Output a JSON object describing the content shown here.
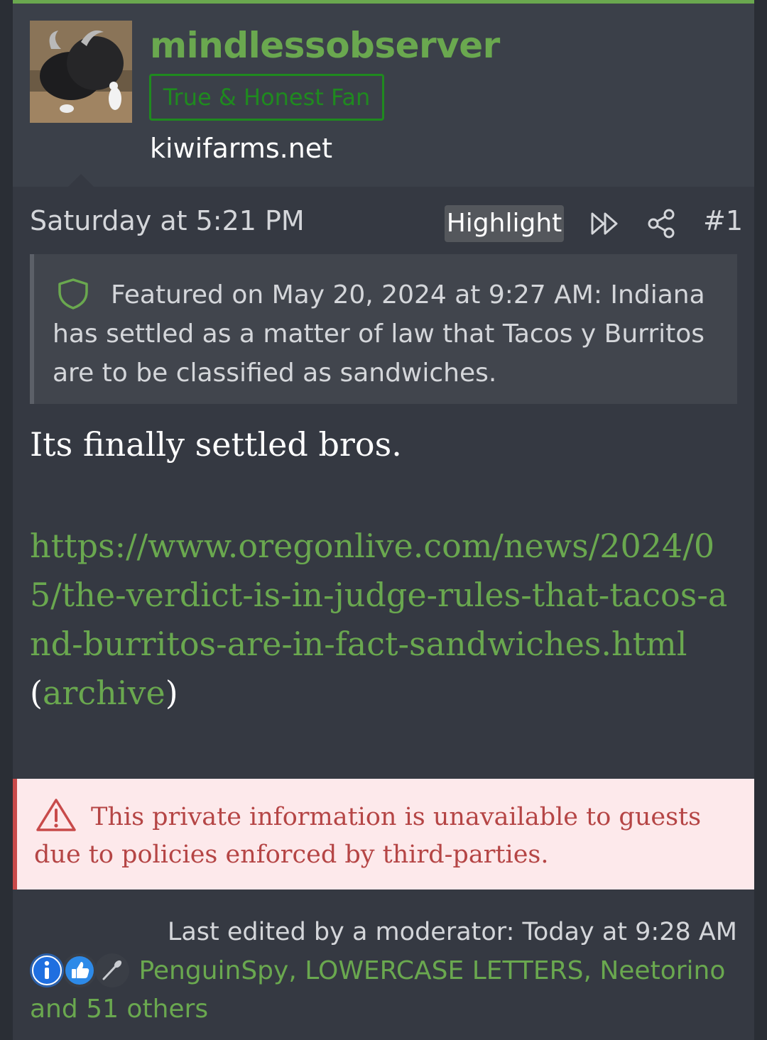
{
  "user": {
    "username": "mindlessobserver",
    "title": "True & Honest Fan",
    "site": "kiwifarms.net"
  },
  "post": {
    "date": "Saturday at 5:21 PM",
    "highlight_label": "Highlight",
    "number": "#1",
    "featured_text": "Featured on May 20, 2024 at 9:27 AM: Indiana has settled as a matter of law that Tacos y Burritos are to be classified as sandwiches.",
    "body_line": "Its finally settled bros.",
    "link_url": "https://www.oregonlive.com/news/2024/05/the-verdict-is-in-judge-rules-that-tacos-and-burritos-are-in-fact-sandwiches.html",
    "archive_open": "(",
    "archive_label": "archive",
    "archive_close": ")"
  },
  "notice": {
    "text": "This private information is unavailable to guests due to policies enforced by third-parties."
  },
  "footer": {
    "last_edited": "Last edited by a moderator: Today at 9:28 AM",
    "reaction_users": "PenguinSpy, LOWERCASE LETTERS, Neetorino and 51 others"
  },
  "icons": {
    "jump": "double-chevron-right-icon",
    "share": "share-icon",
    "featured": "shield-icon",
    "warning": "warning-triangle-icon",
    "reactions": [
      "informative-icon",
      "like-icon",
      "spoon-icon"
    ]
  },
  "colors": {
    "accent": "#6aa84f",
    "title_badge": "#1f8a1f",
    "background": "#353942",
    "notice_bg": "#fde9eb",
    "notice_text": "#b54545"
  }
}
